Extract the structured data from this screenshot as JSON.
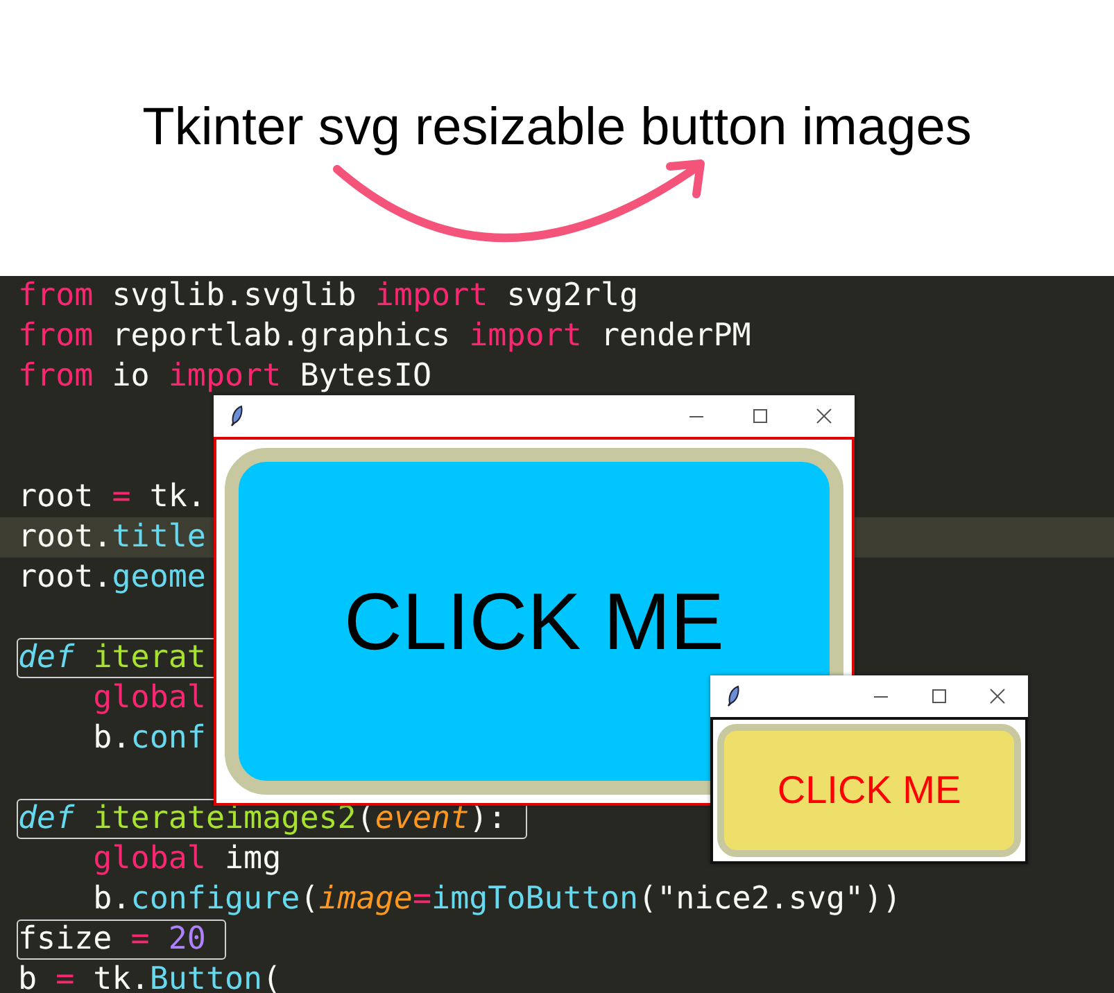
{
  "header": {
    "title": "Tkinter svg resizable button images"
  },
  "code": {
    "lines": [
      {
        "highlighted": false,
        "boxed": false,
        "tokens": [
          {
            "text": "from",
            "kind": "keyword"
          },
          {
            "text": " svglib.svglib ",
            "kind": "plain"
          },
          {
            "text": "import",
            "kind": "keyword"
          },
          {
            "text": " svg2rlg",
            "kind": "plain"
          }
        ]
      },
      {
        "highlighted": false,
        "boxed": false,
        "tokens": [
          {
            "text": "from",
            "kind": "keyword"
          },
          {
            "text": " reportlab.graphics ",
            "kind": "plain"
          },
          {
            "text": "import",
            "kind": "keyword"
          },
          {
            "text": " renderPM",
            "kind": "plain"
          }
        ]
      },
      {
        "highlighted": false,
        "boxed": false,
        "tokens": [
          {
            "text": "from",
            "kind": "keyword"
          },
          {
            "text": " io ",
            "kind": "plain"
          },
          {
            "text": "import",
            "kind": "keyword"
          },
          {
            "text": " BytesIO",
            "kind": "plain"
          }
        ]
      },
      {
        "highlighted": false,
        "boxed": false
      },
      {
        "highlighted": false,
        "boxed": false
      },
      {
        "highlighted": false,
        "boxed": false,
        "tokens": [
          {
            "text": "root ",
            "kind": "plain"
          },
          {
            "text": "=",
            "kind": "keyword"
          },
          {
            "text": " tk.",
            "kind": "plain"
          }
        ]
      },
      {
        "highlighted": true,
        "boxed": false,
        "tokens": [
          {
            "text": "root.",
            "kind": "plain"
          },
          {
            "text": "title",
            "kind": "function"
          }
        ]
      },
      {
        "highlighted": false,
        "boxed": false,
        "tokens": [
          {
            "text": "root.",
            "kind": "plain"
          },
          {
            "text": "geome",
            "kind": "function"
          }
        ]
      },
      {
        "highlighted": false,
        "boxed": false
      },
      {
        "highlighted": false,
        "boxed": true,
        "tokens": [
          {
            "text": "def ",
            "kind": "storage"
          },
          {
            "text": "iterat",
            "kind": "name"
          }
        ]
      },
      {
        "highlighted": false,
        "boxed": false,
        "tokens": [
          {
            "text": "    global",
            "kind": "keyword"
          }
        ]
      },
      {
        "highlighted": false,
        "boxed": false,
        "tokens": [
          {
            "text": "    b.",
            "kind": "plain"
          },
          {
            "text": "conf",
            "kind": "function"
          }
        ]
      },
      {
        "highlighted": false,
        "boxed": false
      },
      {
        "highlighted": false,
        "boxed": true,
        "tokens": [
          {
            "text": "def ",
            "kind": "storage"
          },
          {
            "text": "iterateimages2",
            "kind": "name"
          },
          {
            "text": "(",
            "kind": "plain"
          },
          {
            "text": "event",
            "kind": "param"
          },
          {
            "text": "):",
            "kind": "plain"
          }
        ]
      },
      {
        "highlighted": false,
        "boxed": false,
        "tokens": [
          {
            "text": "    global",
            "kind": "keyword"
          },
          {
            "text": " img",
            "kind": "plain"
          }
        ]
      },
      {
        "highlighted": false,
        "boxed": false,
        "tokens": [
          {
            "text": "    b.",
            "kind": "plain"
          },
          {
            "text": "configure",
            "kind": "function"
          },
          {
            "text": "(",
            "kind": "plain"
          },
          {
            "text": "image",
            "kind": "param"
          },
          {
            "text": "=",
            "kind": "keyword"
          },
          {
            "text": "imgToButton",
            "kind": "function"
          },
          {
            "text": "(\"nice2.svg\"))",
            "kind": "plain"
          }
        ]
      },
      {
        "highlighted": false,
        "boxed": true,
        "tokens": [
          {
            "text": "fsize ",
            "kind": "plain"
          },
          {
            "text": "=",
            "kind": "keyword"
          },
          {
            "text": " 20",
            "kind": "number"
          }
        ]
      },
      {
        "highlighted": false,
        "boxed": false,
        "tokens": [
          {
            "text": "b ",
            "kind": "plain"
          },
          {
            "text": "=",
            "kind": "keyword"
          },
          {
            "text": " tk.",
            "kind": "plain"
          },
          {
            "text": "Button",
            "kind": "function"
          },
          {
            "text": "(",
            "kind": "plain"
          }
        ]
      }
    ]
  },
  "windows": [
    {
      "kind": "blue",
      "button": {
        "label": "CLICK ME"
      }
    },
    {
      "kind": "yellow",
      "button": {
        "label": "CLICK ME"
      }
    }
  ]
}
